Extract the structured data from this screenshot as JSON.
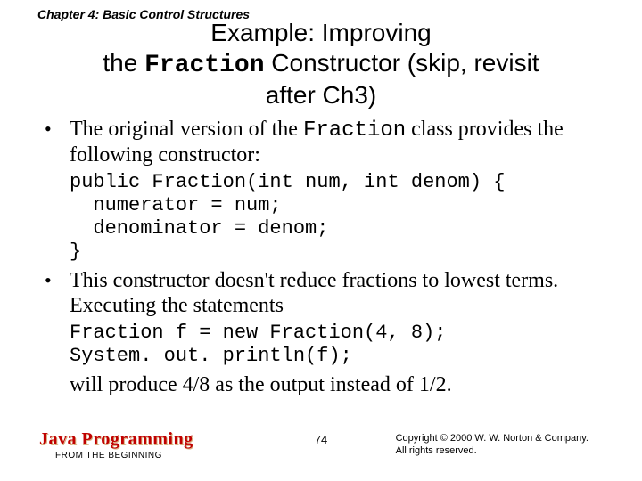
{
  "chapter_header": "Chapter 4: Basic Control Structures",
  "title": {
    "line1_prefix": "Example: Improving",
    "line2_prefix": "the ",
    "line2_mono": "Fraction",
    "line2_suffix": " Constructor (skip, revisit",
    "line3": "after  Ch3)"
  },
  "bullets": [
    {
      "before_mono": "The original version of the ",
      "mono": "Fraction",
      "after_mono": " class provides the following constructor:"
    },
    {
      "before_mono": "This constructor doesn't reduce fractions to lowest terms. Executing the statements",
      "mono": "",
      "after_mono": ""
    }
  ],
  "code1": "public Fraction(int num, int denom) {\n  numerator = num;\n  denominator = denom;\n}",
  "code2": "Fraction f = new Fraction(4, 8);\nSystem. out. println(f);",
  "conclusion": "will produce 4/8 as the output instead of 1/2.",
  "footer": {
    "brand": "Java Programming",
    "sub": "FROM THE BEGINNING",
    "page": "74",
    "copyright_line1": "Copyright © 2000 W. W. Norton & Company.",
    "copyright_line2": "All rights reserved."
  },
  "chart_data": null
}
